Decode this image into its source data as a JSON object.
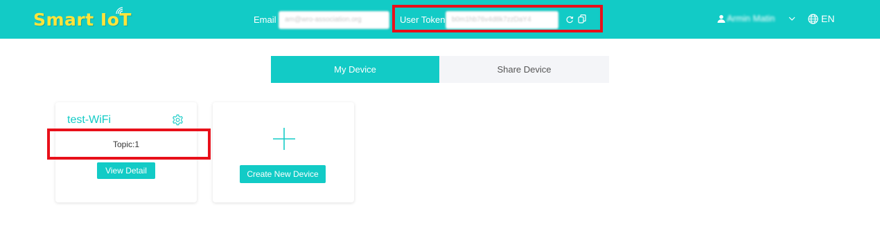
{
  "header": {
    "logo_text": "Smart IoT",
    "email_label": "Email",
    "email_value": "am@wro-association.org",
    "token_label": "User Token",
    "token_value": "b0m1hb76v4d8k7zzDaY4",
    "user_name": "Armin Matin",
    "language": "EN"
  },
  "tabs": [
    {
      "label": "My Device",
      "active": true
    },
    {
      "label": "Share Device",
      "active": false
    }
  ],
  "devices": [
    {
      "name": "test-WiFi",
      "topic_text": "Topic:1",
      "detail_button": "View Detail"
    }
  ],
  "create_card": {
    "button_label": "Create New Device"
  },
  "colors": {
    "accent": "#12cbc6",
    "logo": "#ffe43a",
    "highlight": "#e8101a",
    "tab_bg": "#f4f5f8"
  },
  "icons": [
    "wifi-icon",
    "refresh-icon",
    "copy-icon",
    "user-icon",
    "chevron-down-icon",
    "globe-icon",
    "gear-icon",
    "plus-icon"
  ]
}
